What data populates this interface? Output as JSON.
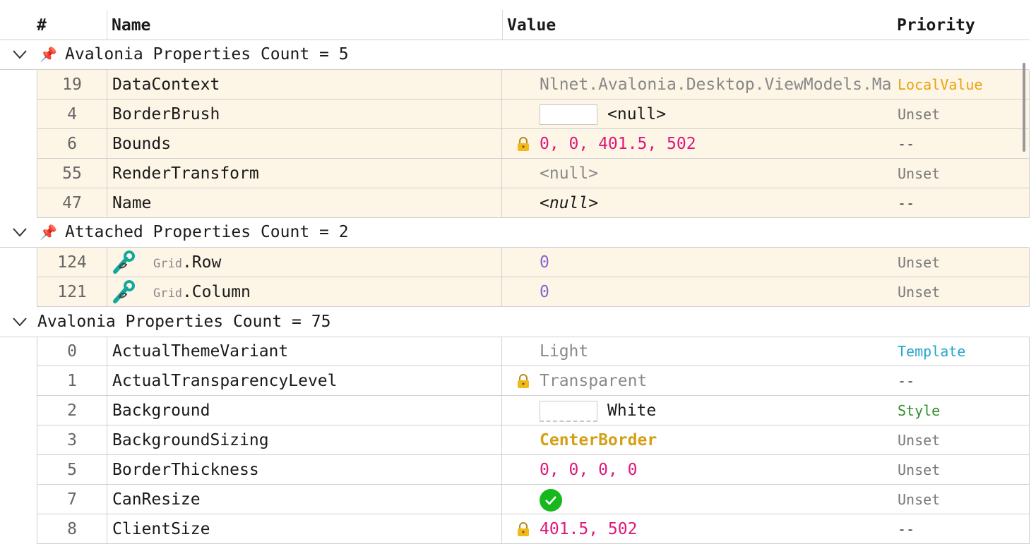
{
  "columns": {
    "num": "#",
    "name": "Name",
    "value": "Value",
    "priority": "Priority"
  },
  "groups": [
    {
      "title": "Avalonia Properties Count = 5",
      "pinned": true
    },
    {
      "title": "Attached Properties Count = 2",
      "pinned": true
    },
    {
      "title": "Avalonia Properties Count = 75",
      "pinned": false
    }
  ],
  "rows": [
    {
      "num": "19",
      "name": "DataContext",
      "value": "Nlnet.Avalonia.Desktop.ViewModels.MainWindowViewModel",
      "priority": "LocalValue"
    },
    {
      "num": "4",
      "name": "BorderBrush",
      "value": "<null>",
      "priority": "Unset"
    },
    {
      "num": "6",
      "name": "Bounds",
      "value": "0, 0, 401.5, 502",
      "priority": "--"
    },
    {
      "num": "55",
      "name": "RenderTransform",
      "value": "<null>",
      "priority": "Unset"
    },
    {
      "num": "47",
      "name": "Name",
      "value": "<null>",
      "priority": "--"
    },
    {
      "num": "124",
      "ns": "Grid",
      "name": ".Row",
      "value": "0",
      "priority": "Unset"
    },
    {
      "num": "121",
      "ns": "Grid",
      "name": ".Column",
      "value": "0",
      "priority": "Unset"
    },
    {
      "num": "0",
      "name": "ActualThemeVariant",
      "value": "Light",
      "priority": "Template"
    },
    {
      "num": "1",
      "name": "ActualTransparencyLevel",
      "value": "Transparent",
      "priority": "--"
    },
    {
      "num": "2",
      "name": "Background",
      "value": "White",
      "priority": "Style"
    },
    {
      "num": "3",
      "name": "BackgroundSizing",
      "value": "CenterBorder",
      "priority": "Unset"
    },
    {
      "num": "5",
      "name": "BorderThickness",
      "value": "0, 0, 0, 0",
      "priority": "Unset"
    },
    {
      "num": "7",
      "name": "CanResize",
      "value": "",
      "priority": "Unset"
    },
    {
      "num": "8",
      "name": "ClientSize",
      "value": "401.5, 502",
      "priority": "--"
    }
  ],
  "colors": {
    "row_highlight": "#fdf5e6",
    "local_value": "#eba10c",
    "template": "#22a7c9",
    "style": "#2f8f2f",
    "numeric": "#e0177b",
    "check": "#16b81e"
  }
}
